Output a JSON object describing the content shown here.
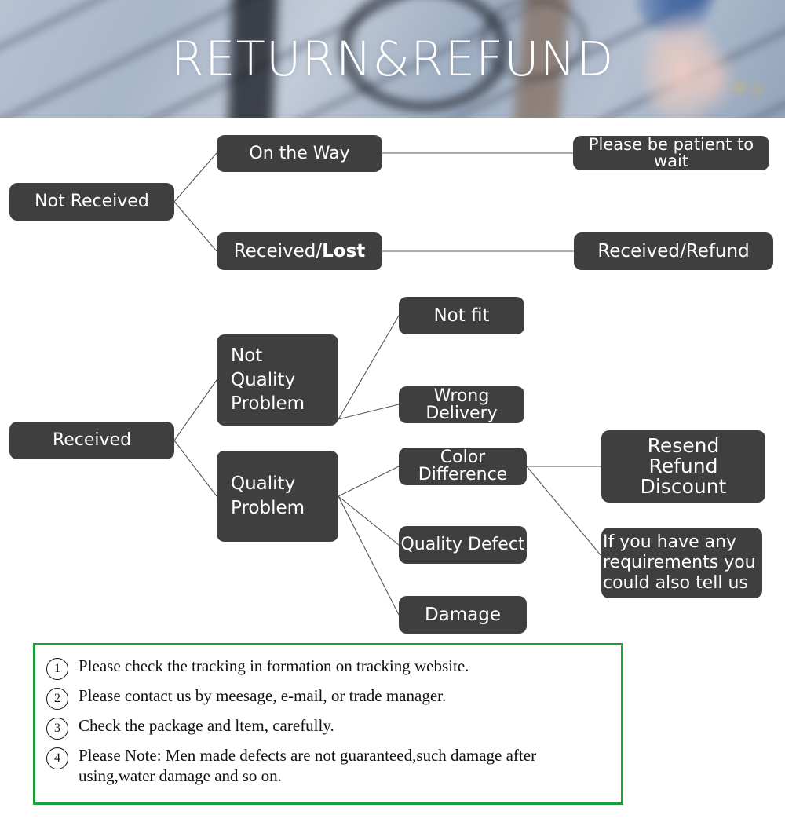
{
  "banner": {
    "title": "RETURN&REFUND"
  },
  "colors": {
    "node_fill": "#3f3f3f",
    "node_text": "#ffffff",
    "connector": "#555555",
    "notes_border": "#1aa03a",
    "notes_text": "#111111",
    "banner_title": "#ffffff"
  },
  "diagram": {
    "nodes": [
      {
        "id": "not-received",
        "label": "Not Received"
      },
      {
        "id": "on-the-way",
        "label": "On the Way"
      },
      {
        "id": "please-be-patient",
        "label": "Please be patient to wait"
      },
      {
        "id": "received-lost",
        "label_plain": "Received/",
        "label_bold": "Lost"
      },
      {
        "id": "received-refund",
        "label": "Received/Refund"
      },
      {
        "id": "received",
        "label": "Received"
      },
      {
        "id": "not-quality-problem",
        "label": "Not\nQuality\nProblem"
      },
      {
        "id": "not-fit",
        "label": "Not fit"
      },
      {
        "id": "wrong-delivery",
        "label": "Wrong Delivery"
      },
      {
        "id": "quality-problem",
        "label": "Quality\nProblem"
      },
      {
        "id": "color-difference",
        "label": "Color Difference"
      },
      {
        "id": "quality-defect",
        "label": "Quality Defect"
      },
      {
        "id": "damage",
        "label": "Damage"
      },
      {
        "id": "resend-refund-discount",
        "label": "Resend\nRefund\nDiscount"
      },
      {
        "id": "if-you-have-any-requirements",
        "label": "If you have any\nrequirements you\ncould also tell us"
      }
    ]
  },
  "notes": {
    "items": [
      {
        "number": "1",
        "text": "Please check the tracking in formation on tracking website."
      },
      {
        "number": "2",
        "text": "Please contact us by meesage, e-mail, or trade manager."
      },
      {
        "number": "3",
        "text": "Check the package and ltem, carefully."
      },
      {
        "number": "4",
        "text": "Please Note: Men made defects  are not guaranteed,such damage after using,water damage and so on."
      }
    ]
  }
}
